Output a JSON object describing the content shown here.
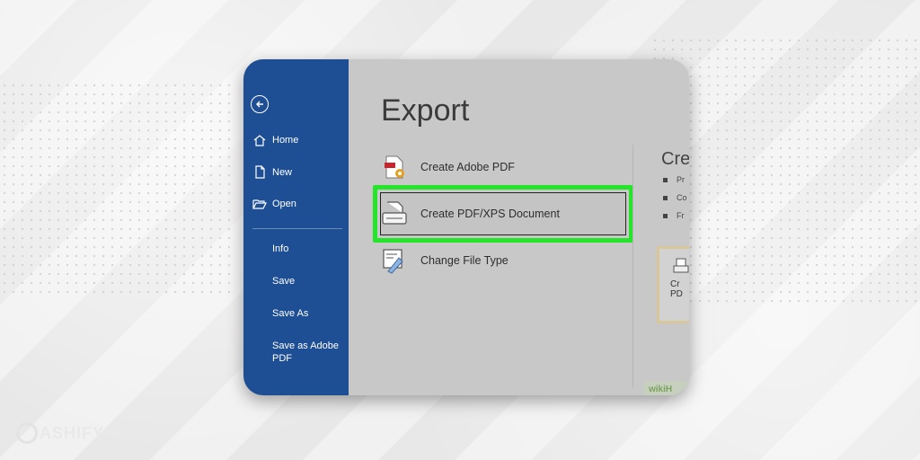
{
  "sidebar": {
    "items": [
      {
        "label": "Home",
        "icon": "home-icon"
      },
      {
        "label": "New",
        "icon": "new-document-icon"
      },
      {
        "label": "Open",
        "icon": "folder-open-icon"
      }
    ],
    "text_items": [
      "Info",
      "Save",
      "Save As",
      "Save as Adobe PDF"
    ]
  },
  "main": {
    "title": "Export",
    "options": [
      {
        "label": "Create Adobe PDF",
        "icon": "adobe-pdf-icon"
      },
      {
        "label": "Create PDF/XPS Document",
        "icon": "pdf-xps-document-icon",
        "selected": true
      },
      {
        "label": "Change File Type",
        "icon": "change-file-type-icon"
      }
    ],
    "right_panel": {
      "title": "Crea",
      "bullets": [
        "Pr",
        "Co",
        "Fr"
      ],
      "button_label_line1": "Cr",
      "button_label_line2": "PD"
    }
  },
  "watermark": "wikiH",
  "brand": {
    "name": "ASHIFY"
  },
  "colors": {
    "sidebar": "#1e4f95",
    "highlight": "#24e52a",
    "panel": "#c8c8c8"
  }
}
